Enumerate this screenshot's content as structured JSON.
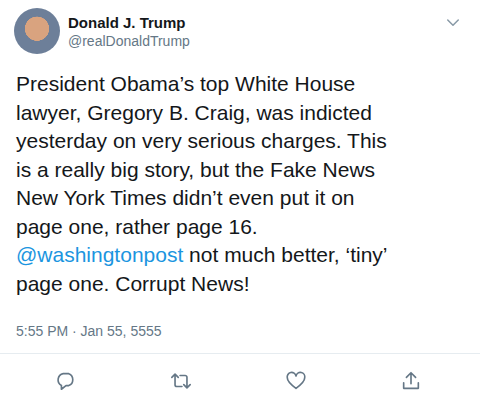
{
  "author": {
    "name": "Donald J. Trump",
    "handle": "@realDonaldTrump"
  },
  "tweet": {
    "lines": [
      [
        {
          "text": "President Obama’s top White House",
          "kind": "text"
        }
      ],
      [
        {
          "text": "lawyer, Gregory B. Craig, was indicted",
          "kind": "text"
        }
      ],
      [
        {
          "text": "yesterday on very serious charges. This",
          "kind": "text"
        }
      ],
      [
        {
          "text": "is a really big story, but the Fake News",
          "kind": "text"
        }
      ],
      [
        {
          "text": "New York Times didn’t even put it on",
          "kind": "text"
        }
      ],
      [
        {
          "text": "page one, rather page 16.",
          "kind": "text"
        }
      ],
      [
        {
          "text": "@washingtonpost",
          "kind": "mention"
        },
        {
          "text": " not much better, ‘tiny’",
          "kind": "text"
        }
      ],
      [
        {
          "text": "page one. Corrupt News!",
          "kind": "text"
        }
      ]
    ],
    "timestamp": "5:55 PM · Jan 55, 5555"
  }
}
